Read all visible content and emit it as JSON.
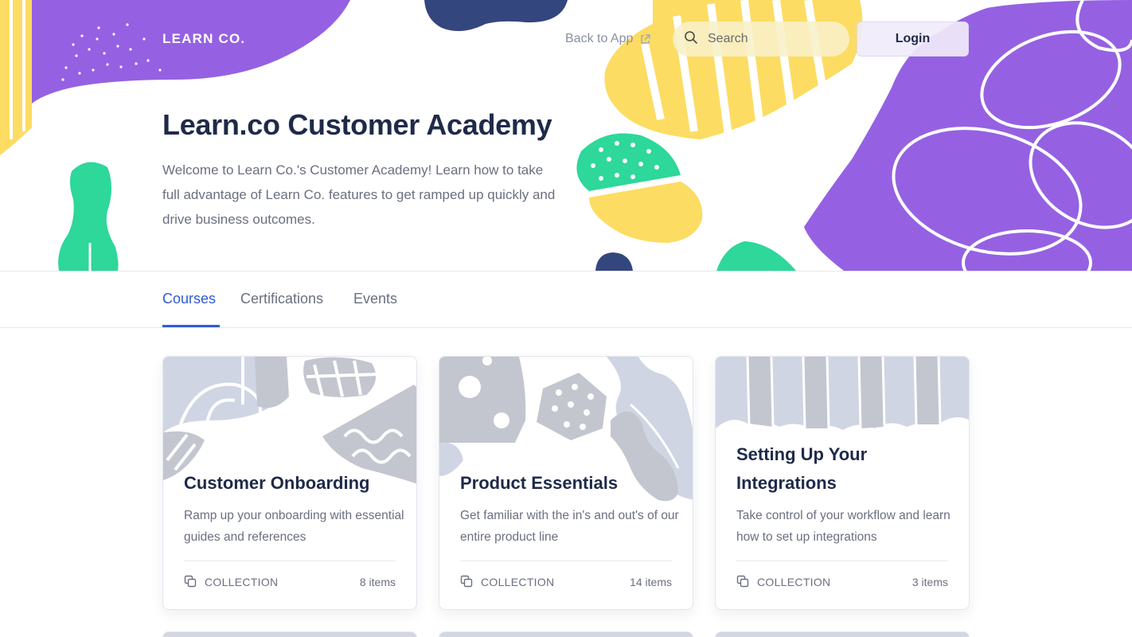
{
  "header": {
    "logo_text": "LEARN CO.",
    "back_link_label": "Back to App",
    "search_placeholder": "Search",
    "login_label": "Login"
  },
  "hero": {
    "title": "Learn.co Customer Academy",
    "description": "Welcome to Learn Co.'s Customer Academy! Learn how to take full advantage of Learn Co. features to get ramped up quickly and drive business outcomes."
  },
  "tabs": [
    {
      "label": "Courses",
      "active": true
    },
    {
      "label": "Certifications",
      "active": false
    },
    {
      "label": "Events",
      "active": false
    }
  ],
  "cards": [
    {
      "title": "Customer Onboarding",
      "description": "Ramp up your onboarding with essential guides and references",
      "type": "COLLECTION",
      "count": "8 items"
    },
    {
      "title": "Product Essentials",
      "description": "Get familiar with the in's and out's of our entire product line",
      "type": "COLLECTION",
      "count": "14 items"
    },
    {
      "title": "Setting Up Your Integrations",
      "description": "Take control of your workflow and learn how to set up integrations",
      "type": "COLLECTION",
      "count": "3 items"
    }
  ],
  "colors": {
    "purple": "#9561e2",
    "yellow": "#fcdc62",
    "green": "#2ed79a",
    "navy": "#34467e",
    "accent_blue": "#2f5ad8",
    "card_art_light": "#d0d5e4",
    "card_art_gray": "#c3c6cf"
  },
  "icons": {
    "back_link": "external-link-icon",
    "search": "search-icon",
    "collection": "collection-icon"
  }
}
